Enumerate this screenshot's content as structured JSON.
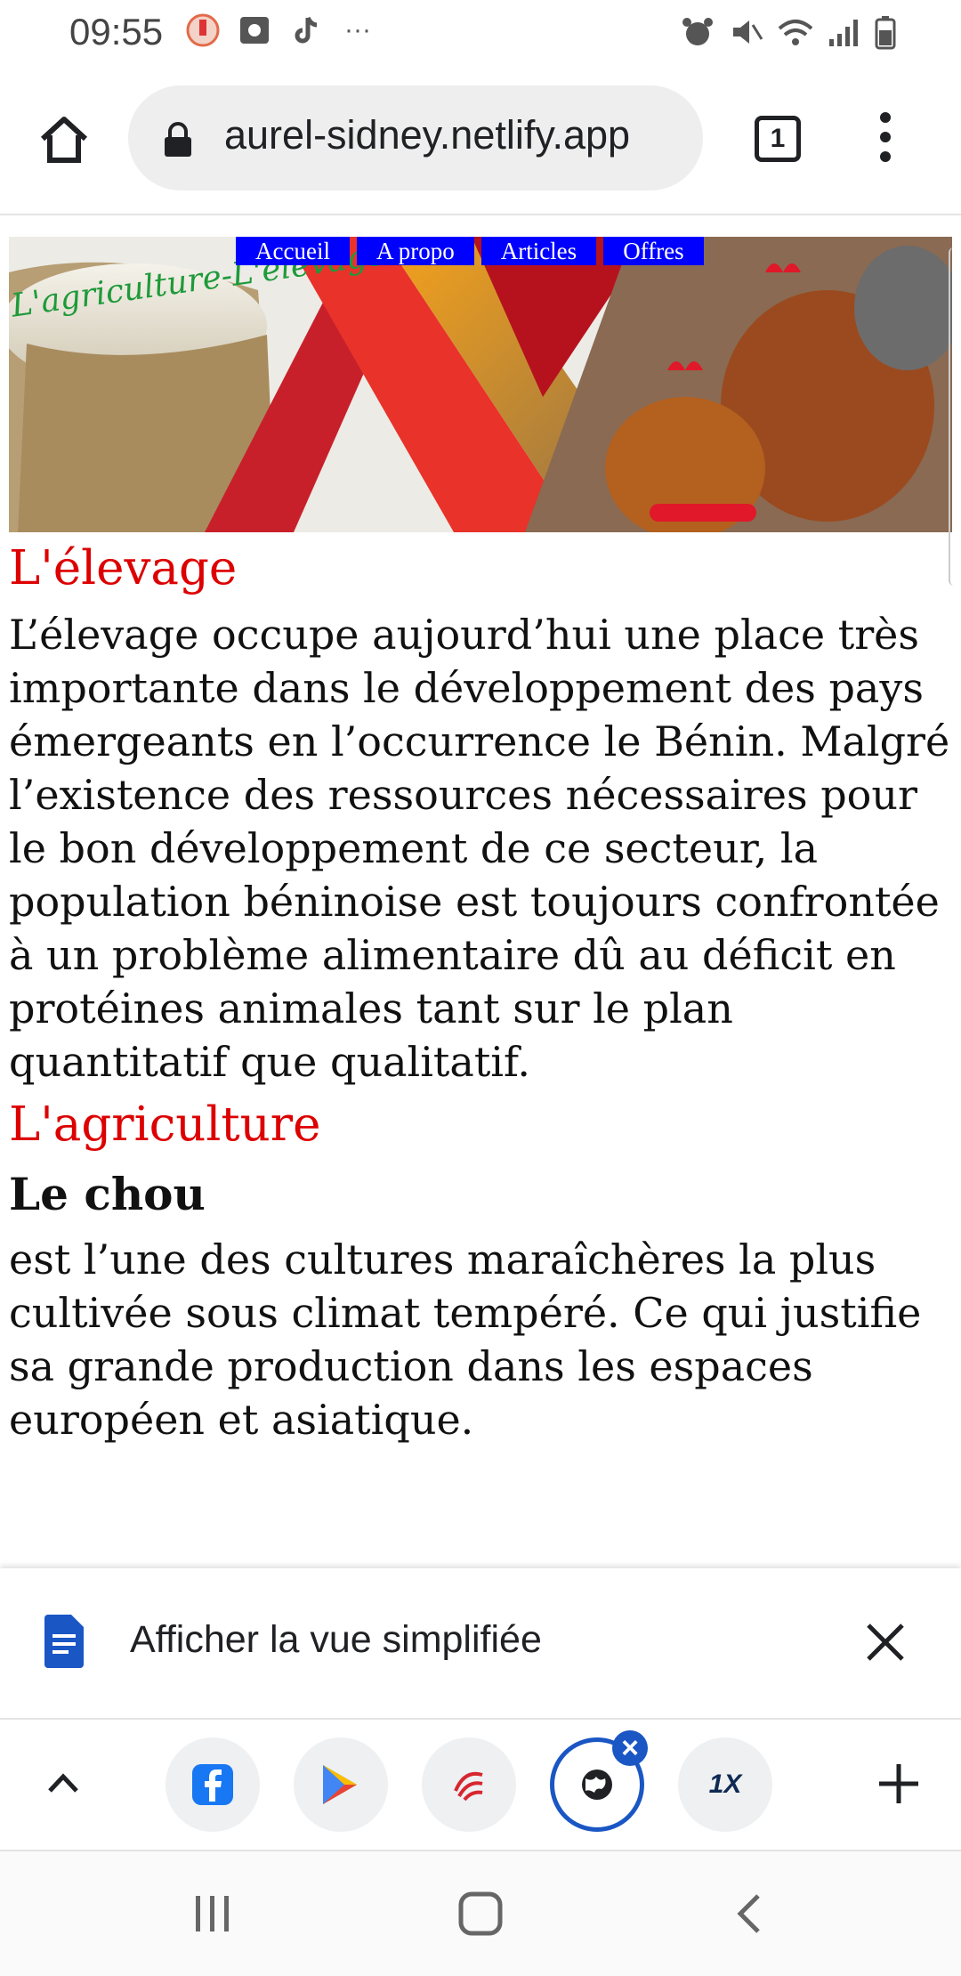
{
  "status_bar": {
    "time": "09:55",
    "overflow": "···"
  },
  "browser": {
    "url": "aurel-sidney.netlify.app",
    "tab_count": "1"
  },
  "banner": {
    "nav": [
      "Accueil",
      "A propo",
      "Articles",
      "Offres"
    ],
    "logo_text": "L'agriculture-L'élevage"
  },
  "content": {
    "h_elevage": "L'élevage",
    "p_elevage": "L’élevage occupe aujourd’hui une place très importante dans le développement des pays émergeants en l’occurrence le Bénin. Malgré l’existence des ressources nécessaires pour le bon développement de ce secteur, la population béninoise est toujours confrontée à un problème alimentaire dû au déficit en protéines animales tant sur le plan quantitatif que qualitatif.",
    "h_agriculture": "L'agriculture",
    "h_chou": "Le chou",
    "p_chou": "est l’une des cultures maraîchères la plus cultivée sous climat tempéré. Ce qui justifie sa grande production dans les espaces européen et asiatique."
  },
  "simplified_view": {
    "label": "Afficher la vue simplifiée"
  },
  "tab_strip": {
    "tabs": [
      "facebook-icon",
      "play-store-icon",
      "red-swirl-icon",
      "globe-icon",
      "1x-icon"
    ],
    "active_index": 3,
    "one_x_label": "1X"
  },
  "colors": {
    "accent": "#1a56c4",
    "heading_red": "#dd0000",
    "nav_blue": "#0000ff"
  }
}
